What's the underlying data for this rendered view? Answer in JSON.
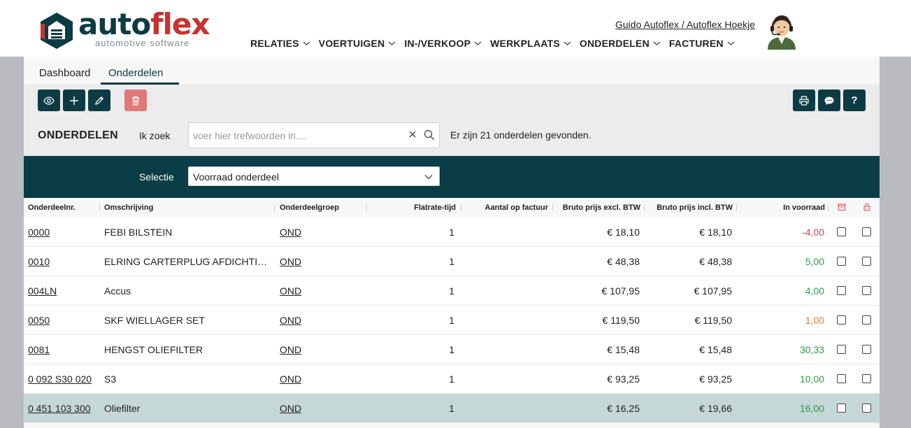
{
  "header": {
    "logo_word_1": "auto",
    "logo_word_2": "flex",
    "logo_sub": "automotive software",
    "user_link": "Guido Autoflex / Autoflex Hoekje",
    "nav": [
      "RELATIES",
      "VOERTUIGEN",
      "IN-/VERKOOP",
      "WERKPLAATS",
      "ONDERDELEN",
      "FACTUREN"
    ]
  },
  "tabs": [
    "Dashboard",
    "Onderdelen"
  ],
  "toolbar": {
    "left_icons": [
      "eye-icon",
      "plus-icon",
      "pencil-icon",
      "trash-icon"
    ],
    "right_icons": [
      "printer-icon",
      "chat-icon",
      "help-icon"
    ],
    "help_label": "?"
  },
  "search": {
    "section_title": "ONDERDELEN",
    "label": "Ik zoek",
    "placeholder": "voer hier trefwoorden in....",
    "value": "",
    "result_text": "Er zijn 21 onderdelen gevonden."
  },
  "selectie": {
    "label": "Selectie",
    "value": "Voorraad onderdeel"
  },
  "table": {
    "headers": {
      "nr": "Onderdeelnr.",
      "desc": "Omschrijving",
      "grp": "Onderdeelgroep",
      "flat": "Flatrate-tijd",
      "aantal": "Aantal op factuur",
      "excl": "Bruto prijs excl. BTW",
      "incl": "Bruto prijs incl. BTW",
      "voor": "In voorraad"
    },
    "rows": [
      {
        "nr": "0000",
        "desc": "FEBI BILSTEIN",
        "grp": "OND",
        "flat": "1",
        "excl": "€ 18,10",
        "incl": "€ 18,10",
        "voor": "-4,00",
        "status": "neg"
      },
      {
        "nr": "0010",
        "desc": "ELRING CARTERPLUG AFDICHTING",
        "grp": "OND",
        "flat": "1",
        "excl": "€ 48,38",
        "incl": "€ 48,38",
        "voor": "5,00",
        "status": "pos"
      },
      {
        "nr": "004LN",
        "desc": "Accus",
        "grp": "OND",
        "flat": "1",
        "excl": "€ 107,95",
        "incl": "€ 107,95",
        "voor": "4,00",
        "status": "pos"
      },
      {
        "nr": "0050",
        "desc": "SKF WIELLAGER SET",
        "grp": "OND",
        "flat": "1",
        "excl": "€ 119,50",
        "incl": "€ 119,50",
        "voor": "1,00",
        "status": "low"
      },
      {
        "nr": "0081",
        "desc": "HENGST OLIEFILTER",
        "grp": "OND",
        "flat": "1",
        "excl": "€ 15,48",
        "incl": "€ 15,48",
        "voor": "30,33",
        "status": "pos"
      },
      {
        "nr": "0 092 S30 020",
        "desc": "S3",
        "grp": "OND",
        "flat": "1",
        "excl": "€ 93,25",
        "incl": "€ 93,25",
        "voor": "10,00",
        "status": "pos"
      },
      {
        "nr": "0 451 103 300",
        "desc": "Oliefilter",
        "grp": "OND",
        "flat": "1",
        "excl": "€ 16,25",
        "incl": "€ 19,66",
        "voor": "16,00",
        "status": "pos",
        "selected": true
      }
    ]
  },
  "colors": {
    "brand_dark": "#0d3b44",
    "brand_red": "#c8332f",
    "stock_negative": "#c94a4a",
    "stock_low": "#e07a2a",
    "stock_positive": "#2e9a4a",
    "selected_row": "#c6d7d8"
  }
}
